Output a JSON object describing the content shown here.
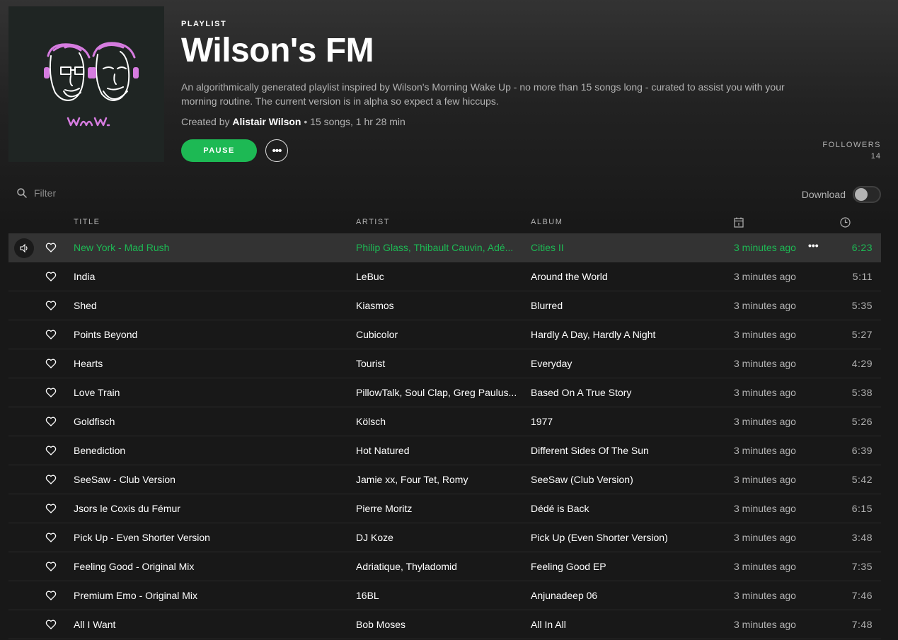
{
  "playlist": {
    "kind_label": "PLAYLIST",
    "title": "Wilson's FM",
    "description": "An algorithmically generated playlist inspired by Wilson's Morning Wake Up - no more than 15 songs long - curated to assist you with your morning routine. The current version is in alpha so expect a few hiccups.",
    "created_by_prefix": "Created by",
    "owner": "Alistair Wilson",
    "stats": " • 15 songs, 1 hr 28 min",
    "cover_text": "wmw."
  },
  "actions": {
    "pause_label": "PAUSE",
    "more_label": "•••"
  },
  "followers": {
    "label": "FOLLOWERS",
    "count": "14"
  },
  "filter": {
    "placeholder": "Filter"
  },
  "download": {
    "label": "Download",
    "enabled": false
  },
  "columns": {
    "title": "TITLE",
    "artist": "ARTIST",
    "album": "ALBUM",
    "date_icon": "calendar-icon",
    "duration_icon": "clock-icon"
  },
  "colors": {
    "accent": "#1db954",
    "background": "#181818",
    "cover_accent": "#d67ce0"
  },
  "tracks": [
    {
      "title": "New York - Mad Rush",
      "artist": "Philip Glass, Thibault Cauvin, Adé...",
      "album": "Cities II",
      "added": "3 minutes ago",
      "duration": "6:23",
      "playing": true
    },
    {
      "title": "India",
      "artist": "LeBuc",
      "album": "Around the World",
      "added": "3 minutes ago",
      "duration": "5:11"
    },
    {
      "title": "Shed",
      "artist": "Kiasmos",
      "album": "Blurred",
      "added": "3 minutes ago",
      "duration": "5:35"
    },
    {
      "title": "Points Beyond",
      "artist": "Cubicolor",
      "album": "Hardly A Day, Hardly A Night",
      "added": "3 minutes ago",
      "duration": "5:27"
    },
    {
      "title": "Hearts",
      "artist": "Tourist",
      "album": "Everyday",
      "added": "3 minutes ago",
      "duration": "4:29"
    },
    {
      "title": "Love Train",
      "artist": "PillowTalk, Soul Clap, Greg Paulus...",
      "album": "Based On A True Story",
      "added": "3 minutes ago",
      "duration": "5:38"
    },
    {
      "title": "Goldfisch",
      "artist": "Kölsch",
      "album": "1977",
      "added": "3 minutes ago",
      "duration": "5:26"
    },
    {
      "title": "Benediction",
      "artist": "Hot Natured",
      "album": "Different Sides Of The Sun",
      "added": "3 minutes ago",
      "duration": "6:39"
    },
    {
      "title": "SeeSaw - Club Version",
      "artist": "Jamie xx, Four Tet, Romy",
      "album": "SeeSaw (Club Version)",
      "added": "3 minutes ago",
      "duration": "5:42"
    },
    {
      "title": "Jsors le Coxis du Fémur",
      "artist": "Pierre Moritz",
      "album": "Dédé is Back",
      "added": "3 minutes ago",
      "duration": "6:15"
    },
    {
      "title": "Pick Up - Even Shorter Version",
      "artist": "DJ Koze",
      "album": "Pick Up (Even Shorter Version)",
      "added": "3 minutes ago",
      "duration": "3:48"
    },
    {
      "title": "Feeling Good - Original Mix",
      "artist": "Adriatique, Thyladomid",
      "album": "Feeling Good EP",
      "added": "3 minutes ago",
      "duration": "7:35"
    },
    {
      "title": "Premium Emo - Original Mix",
      "artist": "16BL",
      "album": "Anjunadeep 06",
      "added": "3 minutes ago",
      "duration": "7:46"
    },
    {
      "title": "All I Want",
      "artist": "Bob Moses",
      "album": "All In All",
      "added": "3 minutes ago",
      "duration": "7:48"
    }
  ],
  "row_more_label": "•••"
}
